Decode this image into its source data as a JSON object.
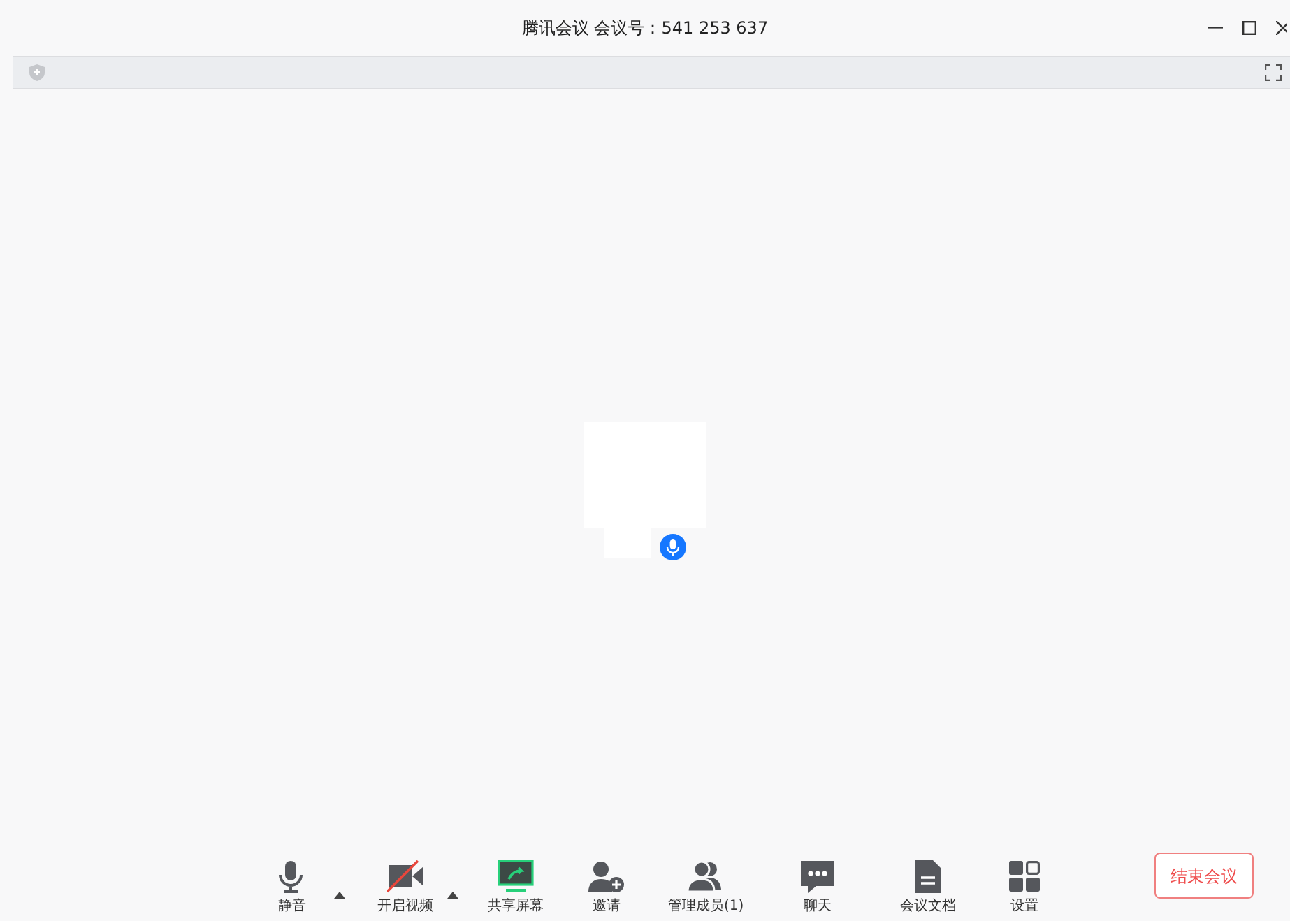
{
  "window": {
    "title": "腾讯会议 会议号：541 253 637"
  },
  "toolbar": [
    {
      "kind": "mic",
      "label": "静音",
      "has_menu": true
    },
    {
      "kind": "video",
      "label": "开启视频",
      "has_menu": true,
      "on": false
    },
    {
      "kind": "share",
      "label": "共享屏幕",
      "has_menu": false
    },
    {
      "kind": "invite",
      "label": "邀请",
      "has_menu": false
    },
    {
      "kind": "members",
      "label": "管理成员(1)",
      "has_menu": false
    },
    {
      "kind": "chat",
      "label": "聊天",
      "has_menu": false
    },
    {
      "kind": "docs",
      "label": "会议文档",
      "has_menu": false
    },
    {
      "kind": "settings",
      "label": "设置",
      "has_menu": false
    }
  ],
  "end_button": "结束会议"
}
